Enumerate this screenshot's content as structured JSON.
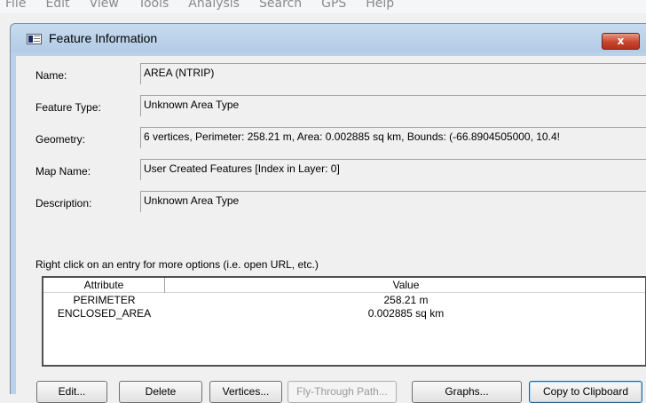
{
  "app_menu": [
    "File",
    "Edit",
    "View",
    "Tools",
    "Analysis",
    "Search",
    "GPS",
    "Help"
  ],
  "window": {
    "title": "Feature Information",
    "close_symbol": "x"
  },
  "fields": {
    "name_label": "Name:",
    "name_value": "AREA   (NTRIP)",
    "type_label": "Feature Type:",
    "type_value": "Unknown Area Type",
    "geometry_label": "Geometry:",
    "geometry_value": "6 vertices, Perimeter: 258.21 m, Area: 0.002885 sq km, Bounds: (-66.8904505000, 10.4!",
    "map_label": "Map Name:",
    "map_value": "User Created Features [Index in Layer: 0]",
    "desc_label": "Description:",
    "desc_value": "Unknown Area Type"
  },
  "hint": "Right click on an entry for more options (i.e. open URL, etc.)",
  "attributes": {
    "columns": [
      "Attribute",
      "Value"
    ],
    "rows": [
      {
        "attribute": "PERIMETER",
        "value": "258.21 m"
      },
      {
        "attribute": "ENCLOSED_AREA",
        "value": "0.002885 sq km"
      }
    ]
  },
  "buttons": {
    "edit": "Edit...",
    "delete": "Delete",
    "vertices": "Vertices...",
    "fly_through": "Fly-Through Path...",
    "graphs": "Graphs...",
    "copy": "Copy to Clipboard"
  }
}
